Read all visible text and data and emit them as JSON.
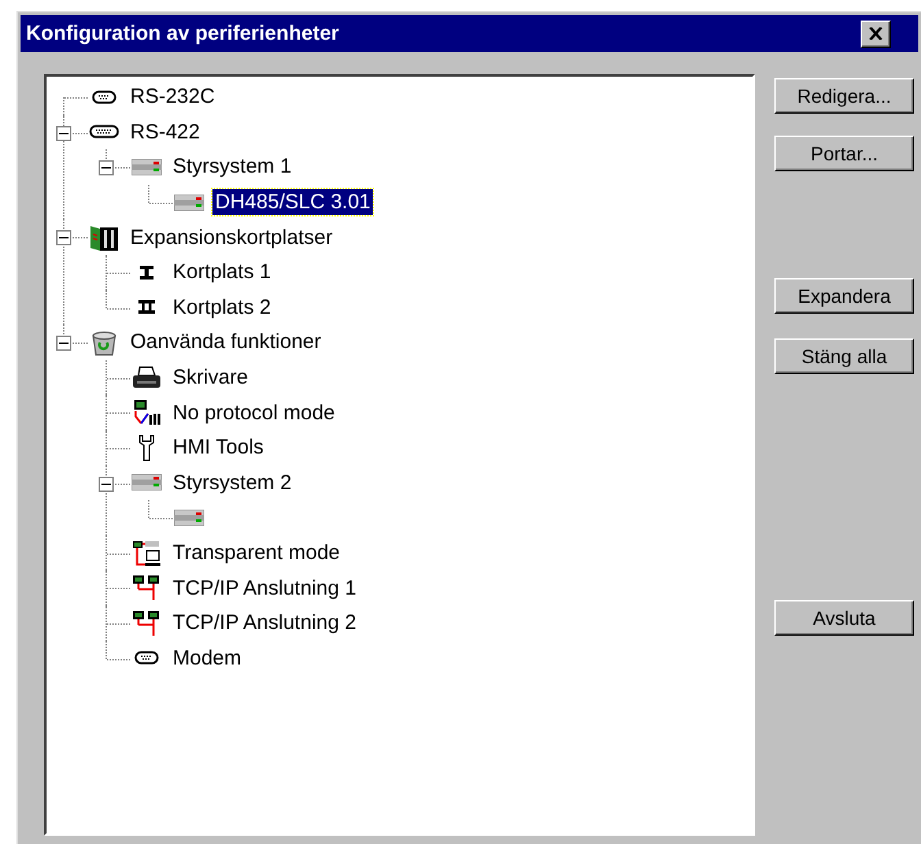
{
  "window": {
    "title": "Konfiguration av periferienheter"
  },
  "tree": [
    {
      "label": "RS-232C",
      "kind": "serial"
    },
    {
      "label": "RS-422",
      "kind": "serial-wide",
      "expanded": true,
      "children": [
        {
          "label": "Styrsystem 1",
          "kind": "controller",
          "expanded": true,
          "children": [
            {
              "label": "DH485/SLC 3.01",
              "kind": "controller",
              "selected": true
            }
          ]
        }
      ]
    },
    {
      "label": "Expansionskortplatser",
      "kind": "expansion",
      "expanded": true,
      "children": [
        {
          "label": "Kortplats 1",
          "kind": "slot-one"
        },
        {
          "label": "Kortplats 2",
          "kind": "slot-two"
        }
      ]
    },
    {
      "label": "Oanvända funktioner",
      "kind": "bin",
      "expanded": true,
      "children": [
        {
          "label": "Skrivare",
          "kind": "printer"
        },
        {
          "label": "No protocol mode",
          "kind": "terminal"
        },
        {
          "label": "HMI Tools",
          "kind": "wrench"
        },
        {
          "label": "Styrsystem 2",
          "kind": "controller",
          "expanded": true,
          "children": [
            {
              "kind": "controller"
            }
          ]
        },
        {
          "label": "Transparent mode",
          "kind": "transparent"
        },
        {
          "label": "TCP/IP Anslutning 1",
          "kind": "network"
        },
        {
          "label": "TCP/IP Anslutning 2",
          "kind": "network"
        },
        {
          "label": "Modem",
          "kind": "serial"
        }
      ]
    }
  ],
  "button_groups": [
    [
      "Redigera...",
      "Portar..."
    ],
    [
      "Expandera",
      "Stäng alla"
    ],
    [
      "Avsluta"
    ]
  ]
}
